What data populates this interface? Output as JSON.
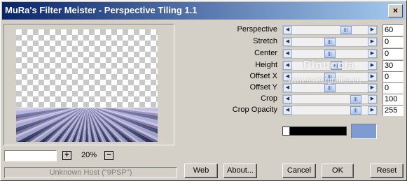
{
  "window": {
    "title": "MuRa's Filter Meister - Perspective Tiling 1.1",
    "close_glyph": "×"
  },
  "preview": {
    "zoom": "20%",
    "zoom_plus": "+",
    "zoom_minus": "−",
    "status": "Unknown Host (\"9PSP\")"
  },
  "params": [
    {
      "label": "Perspective",
      "value": "60",
      "level": 0.75
    },
    {
      "label": "Stretch",
      "value": "0",
      "level": 0.5
    },
    {
      "label": "Center",
      "value": "0",
      "level": 0.5
    },
    {
      "label": "Height",
      "value": "30",
      "level": 0.6
    },
    {
      "label": "Offset X",
      "value": "0",
      "level": 0.5
    },
    {
      "label": "Offset Y",
      "value": "0",
      "level": 0.5
    },
    {
      "label": "Crop",
      "value": "100",
      "level": 0.9
    },
    {
      "label": "Crop Opacity",
      "value": "255",
      "level": 0.9
    }
  ],
  "colors": {
    "swatch": "#7e9bd2",
    "bar": "#000000"
  },
  "watermark": {
    "name": "Pinuccia",
    "url": "www.maidirgrafica.eu"
  },
  "buttons": {
    "web": "Web",
    "about": "About...",
    "cancel": "Cancel",
    "ok": "OK",
    "reset": "Reset"
  }
}
